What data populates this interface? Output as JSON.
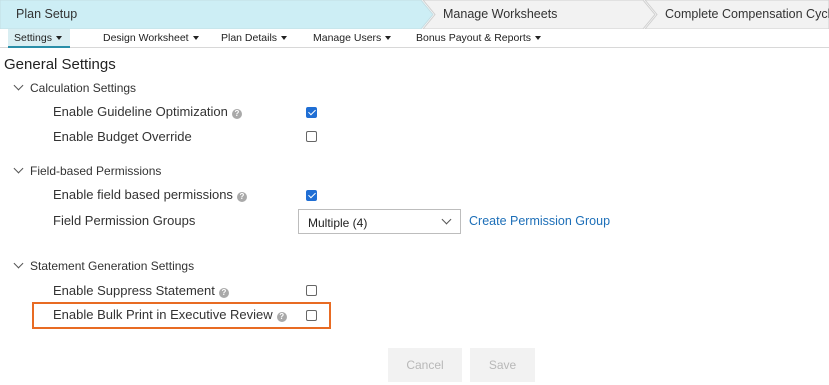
{
  "steps": [
    {
      "label": "Plan Setup"
    },
    {
      "label": "Manage Worksheets"
    },
    {
      "label": "Complete Compensation Cycle"
    }
  ],
  "nav": {
    "items": [
      {
        "label": "Settings"
      },
      {
        "label": "Design Worksheet"
      },
      {
        "label": "Plan Details"
      },
      {
        "label": "Manage Users"
      },
      {
        "label": "Bonus Payout & Reports"
      }
    ]
  },
  "page": {
    "title": "General Settings"
  },
  "sections": {
    "calculation": {
      "title": "Calculation Settings",
      "rows": [
        {
          "label": "Enable Guideline Optimization",
          "checked": true
        },
        {
          "label": "Enable Budget Override",
          "checked": false
        }
      ]
    },
    "field_permissions": {
      "title": "Field-based Permissions",
      "rows": [
        {
          "label": "Enable field based permissions",
          "checked": true
        },
        {
          "label": "Field Permission Groups"
        }
      ],
      "select_value": "Multiple (4)",
      "create_link": "Create Permission Group"
    },
    "statement": {
      "title": "Statement Generation Settings",
      "rows": [
        {
          "label": "Enable Suppress Statement",
          "checked": false
        },
        {
          "label": "Enable Bulk Print in Executive Review",
          "checked": false
        }
      ]
    }
  },
  "buttons": {
    "cancel": "Cancel",
    "save": "Save"
  },
  "help_glyph": "?",
  "colors": {
    "active_step": "#cdeef5",
    "inactive_step": "#f2f2f2",
    "nav_active_underline": "#2a8ea8",
    "checkbox_checked": "#1f6ed4",
    "link": "#1d6fb8",
    "highlight": "#e86b23"
  },
  "icons": {
    "section_toggle": "chevron-down-icon",
    "help": "help-circle-icon",
    "dropdown": "chevron-down-icon",
    "nav_caret": "caret-down-icon"
  }
}
